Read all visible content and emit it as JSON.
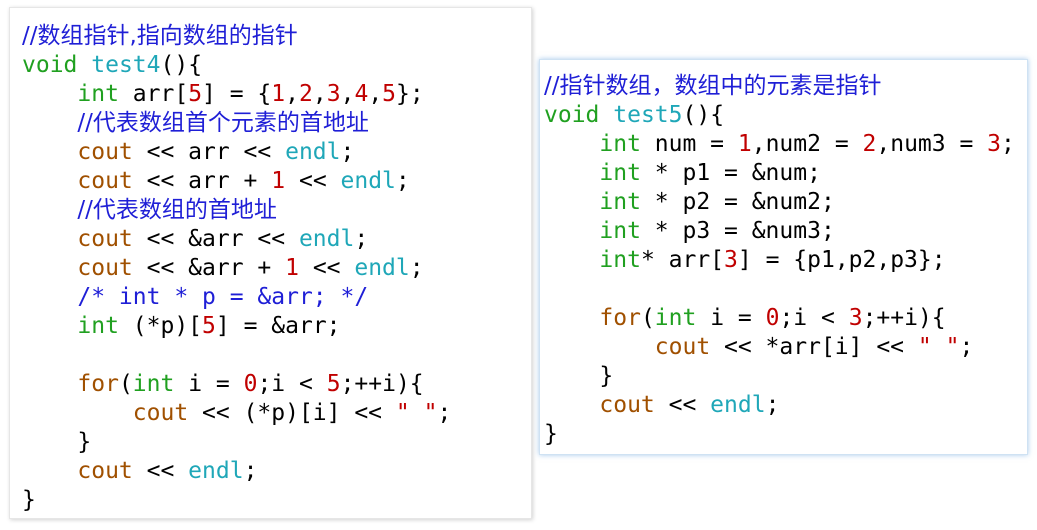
{
  "panels": [
    {
      "id": "panel-left",
      "lines": [
        [
          {
            "t": "//数组指针,指向数组的指针",
            "c": "comment"
          }
        ],
        [
          {
            "t": "void",
            "c": "keyword"
          },
          {
            "t": " ",
            "c": "plain"
          },
          {
            "t": "test4",
            "c": "func"
          },
          {
            "t": "(){",
            "c": "plain"
          }
        ],
        [
          {
            "t": "    ",
            "c": "plain"
          },
          {
            "t": "int",
            "c": "keyword"
          },
          {
            "t": " arr[",
            "c": "plain"
          },
          {
            "t": "5",
            "c": "number"
          },
          {
            "t": "] = {",
            "c": "plain"
          },
          {
            "t": "1",
            "c": "number"
          },
          {
            "t": ",",
            "c": "plain"
          },
          {
            "t": "2",
            "c": "number"
          },
          {
            "t": ",",
            "c": "plain"
          },
          {
            "t": "3",
            "c": "number"
          },
          {
            "t": ",",
            "c": "plain"
          },
          {
            "t": "4",
            "c": "number"
          },
          {
            "t": ",",
            "c": "plain"
          },
          {
            "t": "5",
            "c": "number"
          },
          {
            "t": "};",
            "c": "plain"
          }
        ],
        [
          {
            "t": "    ",
            "c": "plain"
          },
          {
            "t": "//代表数组首个元素的首地址",
            "c": "comment"
          }
        ],
        [
          {
            "t": "    ",
            "c": "plain"
          },
          {
            "t": "cout",
            "c": "flow"
          },
          {
            "t": " << arr << ",
            "c": "plain"
          },
          {
            "t": "endl",
            "c": "func"
          },
          {
            "t": ";",
            "c": "plain"
          }
        ],
        [
          {
            "t": "    ",
            "c": "plain"
          },
          {
            "t": "cout",
            "c": "flow"
          },
          {
            "t": " << arr + ",
            "c": "plain"
          },
          {
            "t": "1",
            "c": "number"
          },
          {
            "t": " << ",
            "c": "plain"
          },
          {
            "t": "endl",
            "c": "func"
          },
          {
            "t": ";",
            "c": "plain"
          }
        ],
        [
          {
            "t": "    ",
            "c": "plain"
          },
          {
            "t": "//代表数组的首地址",
            "c": "comment"
          }
        ],
        [
          {
            "t": "    ",
            "c": "plain"
          },
          {
            "t": "cout",
            "c": "flow"
          },
          {
            "t": " << &arr << ",
            "c": "plain"
          },
          {
            "t": "endl",
            "c": "func"
          },
          {
            "t": ";",
            "c": "plain"
          }
        ],
        [
          {
            "t": "    ",
            "c": "plain"
          },
          {
            "t": "cout",
            "c": "flow"
          },
          {
            "t": " << &arr + ",
            "c": "plain"
          },
          {
            "t": "1",
            "c": "number"
          },
          {
            "t": " << ",
            "c": "plain"
          },
          {
            "t": "endl",
            "c": "func"
          },
          {
            "t": ";",
            "c": "plain"
          }
        ],
        [
          {
            "t": "    ",
            "c": "plain"
          },
          {
            "t": "/* int * p = &arr; */",
            "c": "comment"
          }
        ],
        [
          {
            "t": "    ",
            "c": "plain"
          },
          {
            "t": "int",
            "c": "keyword"
          },
          {
            "t": " (*p)[",
            "c": "plain"
          },
          {
            "t": "5",
            "c": "number"
          },
          {
            "t": "] = &arr;",
            "c": "plain"
          }
        ],
        [
          {
            "t": "",
            "c": "plain"
          }
        ],
        [
          {
            "t": "    ",
            "c": "plain"
          },
          {
            "t": "for",
            "c": "flow"
          },
          {
            "t": "(",
            "c": "plain"
          },
          {
            "t": "int",
            "c": "keyword"
          },
          {
            "t": " i = ",
            "c": "plain"
          },
          {
            "t": "0",
            "c": "number"
          },
          {
            "t": ";i < ",
            "c": "plain"
          },
          {
            "t": "5",
            "c": "number"
          },
          {
            "t": ";++i){",
            "c": "plain"
          }
        ],
        [
          {
            "t": "        ",
            "c": "plain"
          },
          {
            "t": "cout",
            "c": "flow"
          },
          {
            "t": " << (*p)[i] << ",
            "c": "plain"
          },
          {
            "t": "\" \"",
            "c": "string"
          },
          {
            "t": ";",
            "c": "plain"
          }
        ],
        [
          {
            "t": "    }",
            "c": "plain"
          }
        ],
        [
          {
            "t": "    ",
            "c": "plain"
          },
          {
            "t": "cout",
            "c": "flow"
          },
          {
            "t": " << ",
            "c": "plain"
          },
          {
            "t": "endl",
            "c": "func"
          },
          {
            "t": ";",
            "c": "plain"
          }
        ],
        [
          {
            "t": "}",
            "c": "plain"
          }
        ]
      ]
    },
    {
      "id": "panel-right",
      "lines": [
        [
          {
            "t": "//指针数组，数组中的元素是指针",
            "c": "comment"
          }
        ],
        [
          {
            "t": "void",
            "c": "keyword"
          },
          {
            "t": " ",
            "c": "plain"
          },
          {
            "t": "test5",
            "c": "func"
          },
          {
            "t": "(){",
            "c": "plain"
          }
        ],
        [
          {
            "t": "    ",
            "c": "plain"
          },
          {
            "t": "int",
            "c": "keyword"
          },
          {
            "t": " num = ",
            "c": "plain"
          },
          {
            "t": "1",
            "c": "number"
          },
          {
            "t": ",num2 = ",
            "c": "plain"
          },
          {
            "t": "2",
            "c": "number"
          },
          {
            "t": ",num3 = ",
            "c": "plain"
          },
          {
            "t": "3",
            "c": "number"
          },
          {
            "t": ";",
            "c": "plain"
          }
        ],
        [
          {
            "t": "    ",
            "c": "plain"
          },
          {
            "t": "int",
            "c": "keyword"
          },
          {
            "t": " * p1 = &num;",
            "c": "plain"
          }
        ],
        [
          {
            "t": "    ",
            "c": "plain"
          },
          {
            "t": "int",
            "c": "keyword"
          },
          {
            "t": " * p2 = &num2;",
            "c": "plain"
          }
        ],
        [
          {
            "t": "    ",
            "c": "plain"
          },
          {
            "t": "int",
            "c": "keyword"
          },
          {
            "t": " * p3 = &num3;",
            "c": "plain"
          }
        ],
        [
          {
            "t": "    ",
            "c": "plain"
          },
          {
            "t": "int",
            "c": "keyword"
          },
          {
            "t": "* arr[",
            "c": "plain"
          },
          {
            "t": "3",
            "c": "number"
          },
          {
            "t": "] = {p1,p2,p3};",
            "c": "plain"
          }
        ],
        [
          {
            "t": "",
            "c": "plain"
          }
        ],
        [
          {
            "t": "    ",
            "c": "plain"
          },
          {
            "t": "for",
            "c": "flow"
          },
          {
            "t": "(",
            "c": "plain"
          },
          {
            "t": "int",
            "c": "keyword"
          },
          {
            "t": " i = ",
            "c": "plain"
          },
          {
            "t": "0",
            "c": "number"
          },
          {
            "t": ";i < ",
            "c": "plain"
          },
          {
            "t": "3",
            "c": "number"
          },
          {
            "t": ";++i){",
            "c": "plain"
          }
        ],
        [
          {
            "t": "        ",
            "c": "plain"
          },
          {
            "t": "cout",
            "c": "flow"
          },
          {
            "t": " << *arr[i] << ",
            "c": "plain"
          },
          {
            "t": "\" \"",
            "c": "string"
          },
          {
            "t": ";",
            "c": "plain"
          }
        ],
        [
          {
            "t": "    }",
            "c": "plain"
          }
        ],
        [
          {
            "t": "    ",
            "c": "plain"
          },
          {
            "t": "cout",
            "c": "flow"
          },
          {
            "t": " << ",
            "c": "plain"
          },
          {
            "t": "endl",
            "c": "func"
          },
          {
            "t": ";",
            "c": "plain"
          }
        ],
        [
          {
            "t": "}",
            "c": "plain"
          }
        ]
      ]
    }
  ]
}
